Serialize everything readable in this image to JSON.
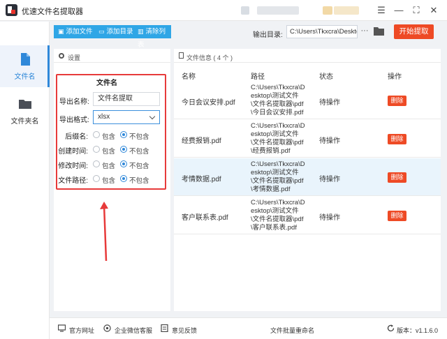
{
  "window": {
    "title": "优速文件名提取器",
    "controls": {
      "menu": "☰",
      "minimize": "—",
      "maximize": "⛶",
      "close": "✕"
    }
  },
  "rail": {
    "items": [
      {
        "label": "文件名",
        "icon": "file-icon",
        "active": true
      },
      {
        "label": "文件夹名",
        "icon": "folder-icon",
        "active": false
      }
    ]
  },
  "toolbar": {
    "add_file": "添加文件",
    "add_folder": "添加目录",
    "clear_list": "清除列表",
    "output_label": "输出目录:",
    "output_path": "C:\\Users\\Tkxcra\\Deskto",
    "browse": "···",
    "start": "开始提取"
  },
  "settings": {
    "header": "设置",
    "group_title": "文件名",
    "export_name_label": "导出名称:",
    "export_name_value": "文件名提取",
    "export_format_label": "导出格式:",
    "export_format_value": "xlsx",
    "options": [
      {
        "label": "后缀名:",
        "include": "包含",
        "exclude": "不包含",
        "selected": "exclude"
      },
      {
        "label": "创建时间:",
        "include": "包含",
        "exclude": "不包含",
        "selected": "exclude"
      },
      {
        "label": "修改时间:",
        "include": "包含",
        "exclude": "不包含",
        "selected": "exclude"
      },
      {
        "label": "文件路径:",
        "include": "包含",
        "exclude": "不包含",
        "selected": "exclude"
      }
    ]
  },
  "files": {
    "header": "文件信息 ( 4 个 )",
    "columns": [
      "名称",
      "路径",
      "状态",
      "操作"
    ],
    "rows": [
      {
        "name": "今日会议安排.pdf",
        "path": [
          "C:\\Users\\Tkxcra\\D",
          "esktop\\测试文件",
          "\\文件名提取器\\pdf",
          "\\今日会议安排.pdf"
        ],
        "status": "待操作",
        "action": "删除"
      },
      {
        "name": "经费报销.pdf",
        "path": [
          "C:\\Users\\Tkxcra\\D",
          "esktop\\测试文件",
          "\\文件名提取器\\pdf",
          "\\经费报销.pdf"
        ],
        "status": "待操作",
        "action": "删除"
      },
      {
        "name": "考情数据.pdf",
        "path": [
          "C:\\Users\\Tkxcra\\D",
          "esktop\\测试文件",
          "\\文件名提取器\\pdf",
          "\\考情数据.pdf"
        ],
        "status": "待操作",
        "action": "删除"
      },
      {
        "name": "客户联系表.pdf",
        "path": [
          "C:\\Users\\Tkxcra\\D",
          "esktop\\测试文件",
          "\\文件名提取器\\pdf",
          "\\客户联系表.pdf"
        ],
        "status": "待操作",
        "action": "删除"
      }
    ]
  },
  "footer": {
    "website": "官方网址",
    "wechat": "企业微信客服",
    "feedback": "意见反馈",
    "batch_rename": "文件批量重命名",
    "version": "版本：v1.1.6.0"
  },
  "colors": {
    "accent": "#2f88d9",
    "toolbar_button": "#2fa6e6",
    "danger": "#ee4a25",
    "highlight_frame": "#e73a3a"
  }
}
